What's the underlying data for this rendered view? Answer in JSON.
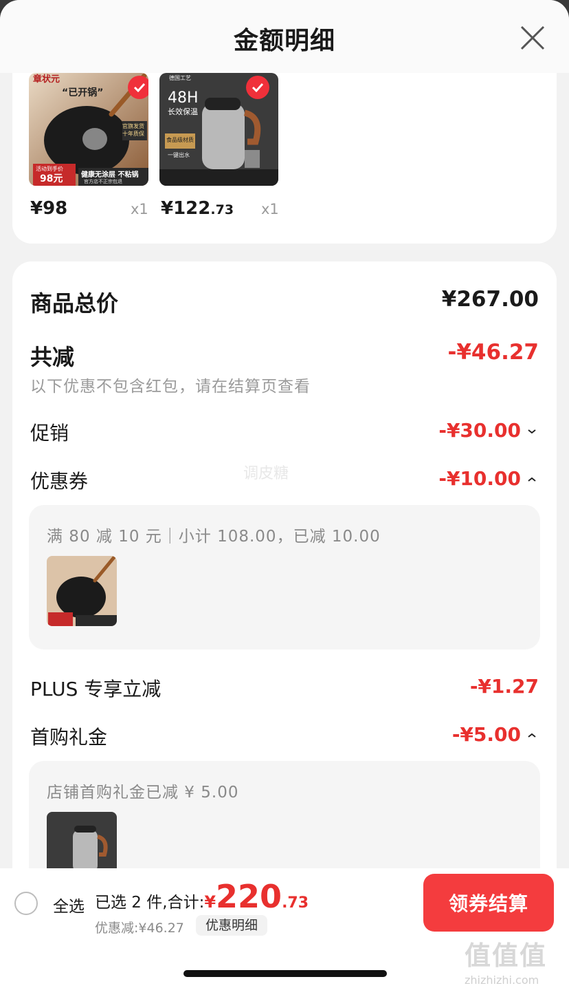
{
  "header": {
    "title": "金额明细"
  },
  "products": [
    {
      "price_int": "¥98",
      "price_dec": "",
      "qty": "x1",
      "thumb_texts": {
        "brand": "章状元",
        "slogan": "“已开锅”",
        "badge": "官旗发货 十年质保",
        "promo": "活动到手价",
        "promo_price": "98元",
        "ribbon": "健康无涂层 不粘锅",
        "ribbon2": "官方店不正宗包退"
      }
    },
    {
      "price_int": "¥122",
      "price_dec": ".73",
      "qty": "x1",
      "thumb_texts": {
        "top": "德国工艺",
        "headline": "48H",
        "sub": "长效保温",
        "tag": "食品级材质",
        "tag2": "一键出水"
      }
    }
  ],
  "summary": {
    "goods_total_label": "商品总价",
    "goods_total_value": "¥267.00",
    "total_off_label": "共减",
    "total_off_value": "-¥46.27",
    "note": "以下优惠不包含红包，请在结算页查看"
  },
  "discounts": {
    "promo": {
      "label": "促销",
      "value": "-¥30.00",
      "chevron": "chevron-down-icon"
    },
    "coupon": {
      "label": "优惠券",
      "value": "-¥10.00",
      "chevron": "chevron-up-icon",
      "detail": "满 80 减 10 元｜小计 108.00，已减 10.00"
    },
    "plus": {
      "label": "PLUS 专享立减",
      "value": "-¥1.27"
    },
    "first_buy": {
      "label": "首购礼金",
      "value": "-¥5.00",
      "chevron": "chevron-up-icon",
      "detail": "店铺首购礼金已减 ¥ 5.00"
    }
  },
  "watermark_text": "调皮糖",
  "bottom": {
    "select_all": "全选",
    "selected_text": "已选 2 件,合计:",
    "total_yen": "¥",
    "total_int": "220",
    "total_dec": ".73",
    "saving_text": "优惠减:¥46.27",
    "detail_button": "优惠明细",
    "checkout_button": "领券结算"
  },
  "site_mark": {
    "logo": "值值值",
    "url": "zhizhizhi.com"
  },
  "colors": {
    "accent_red": "#e8302e",
    "button_red": "#f43c3e",
    "background": "#f2f2f2"
  }
}
